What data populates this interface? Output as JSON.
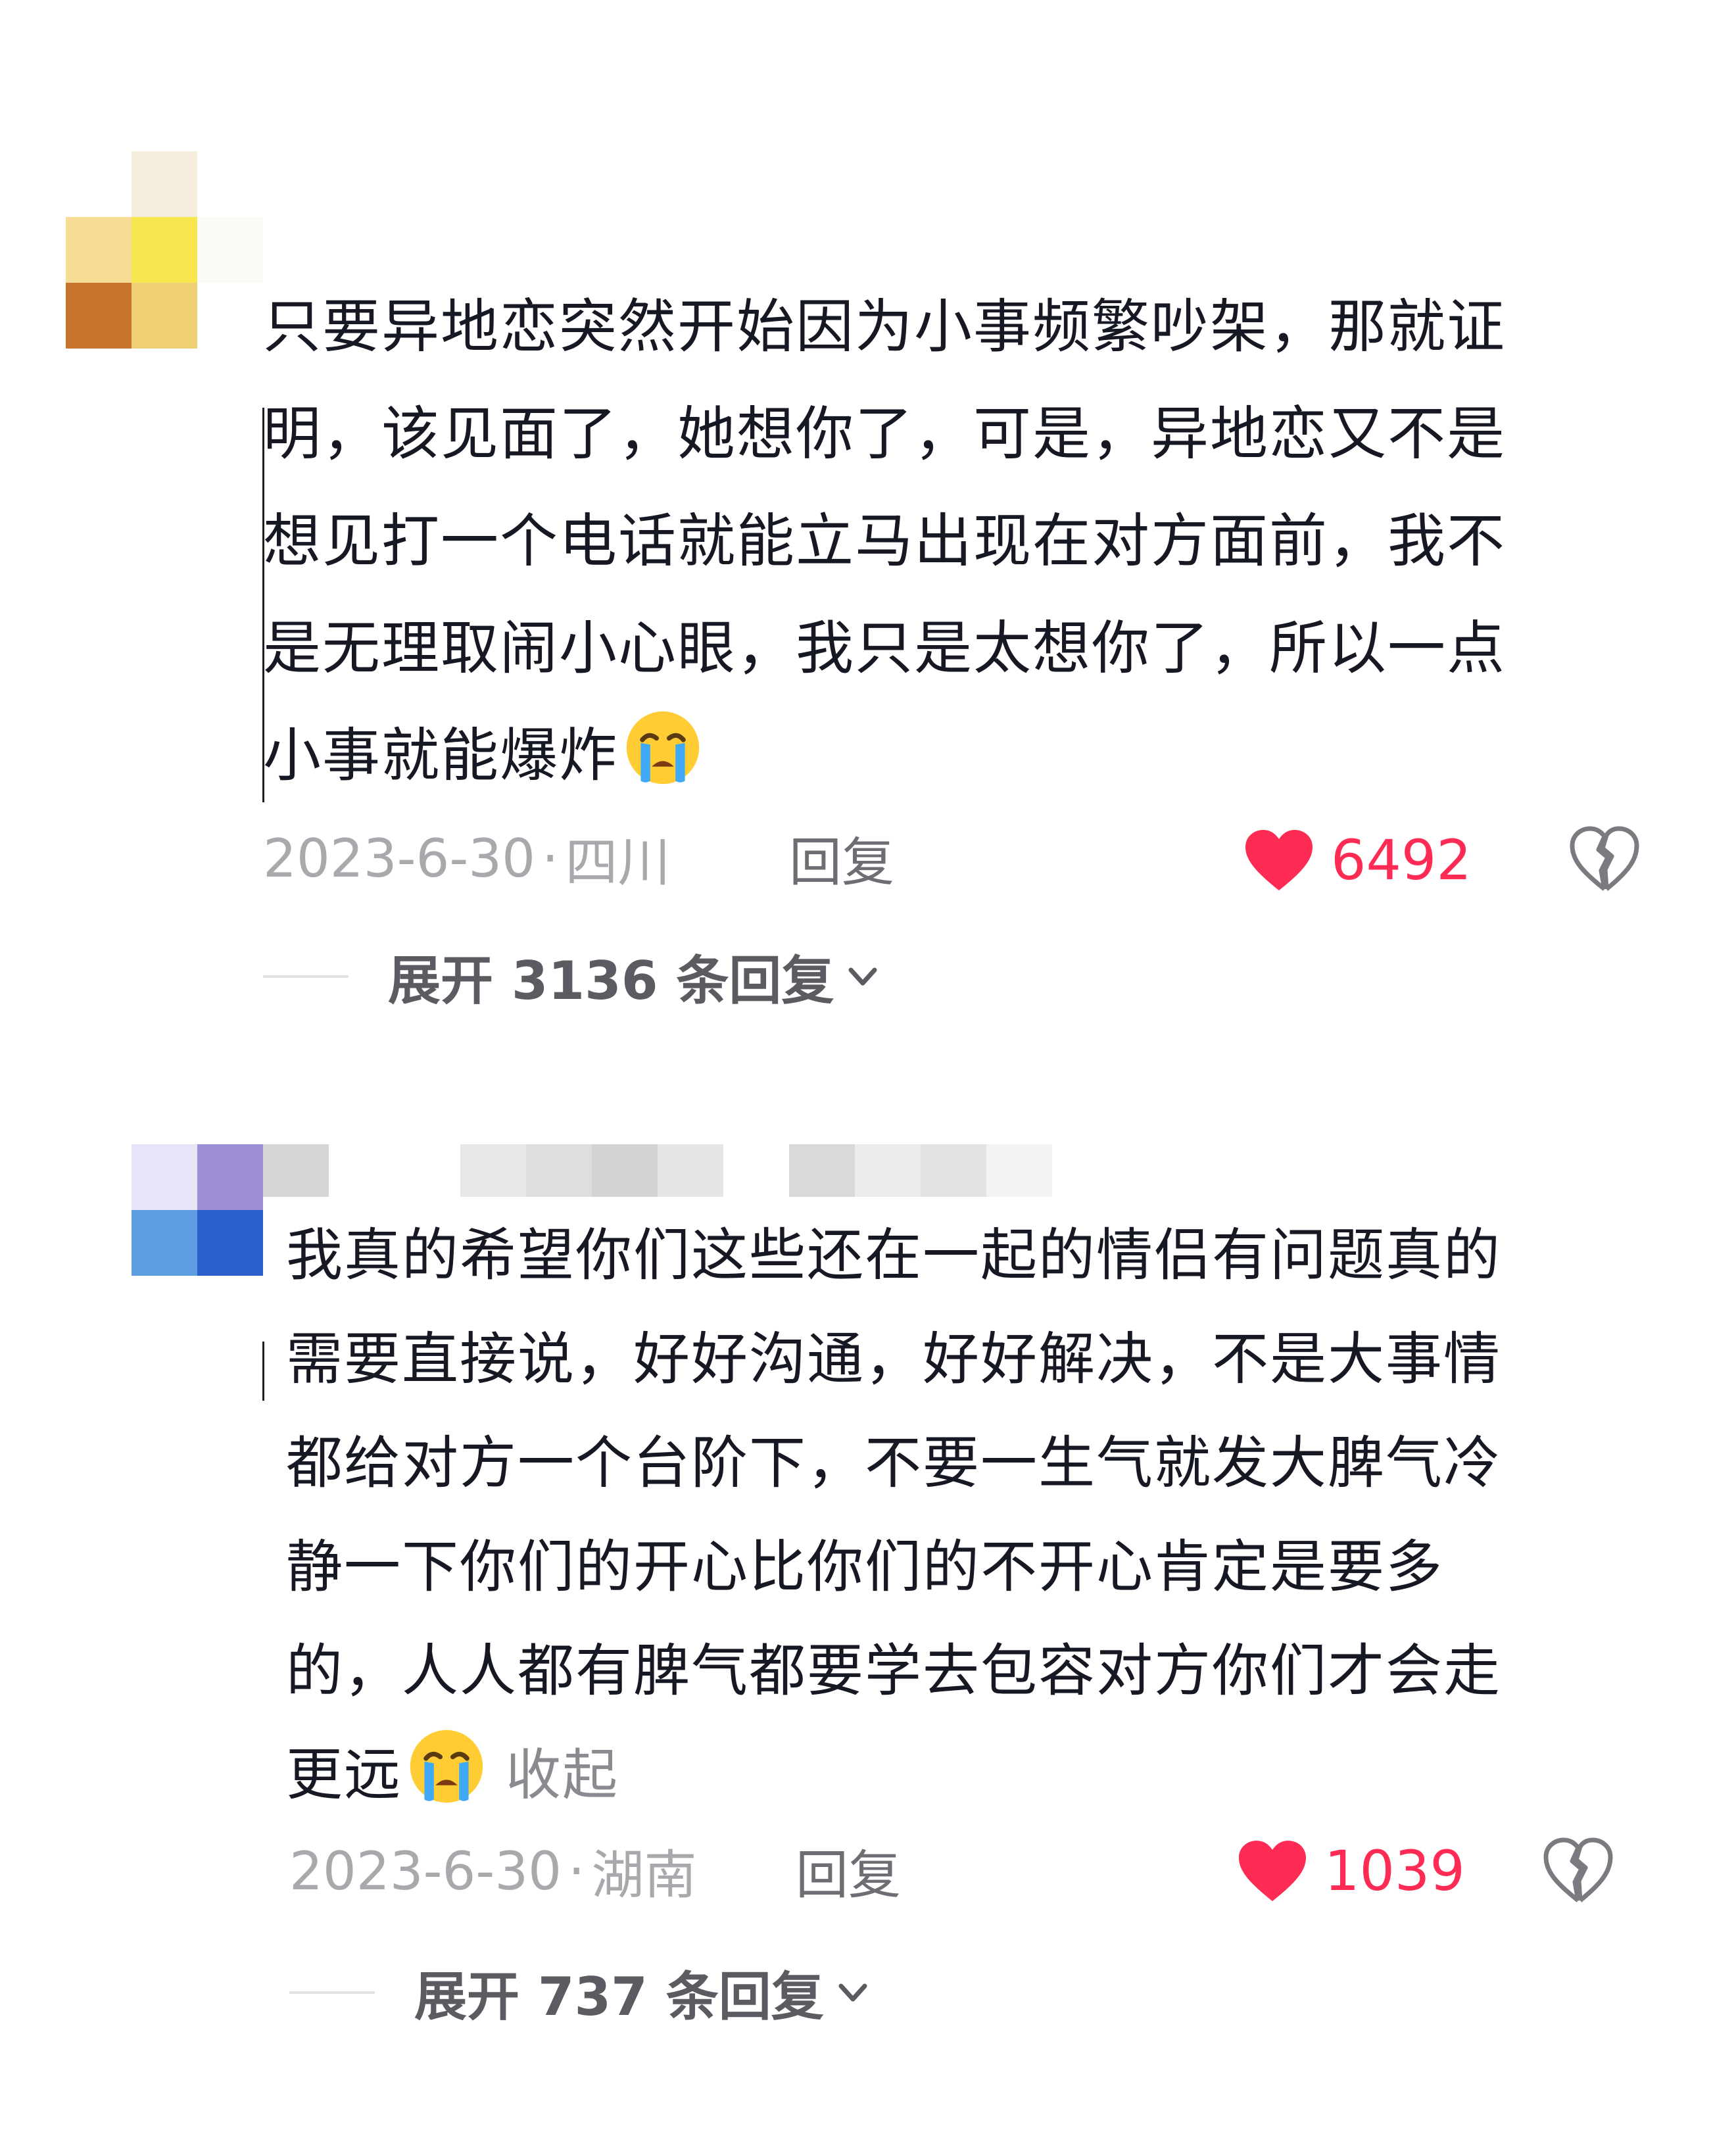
{
  "colors": {
    "accent_like": "#fe2c55",
    "meta_text": "#a8a8ad",
    "body_text": "#161823",
    "reply_text": "#6d6e74"
  },
  "comments": [
    {
      "avatar_pixels": [
        "#ffffff",
        "#f5eedd",
        "#ffffff",
        "#f6dc94",
        "#f8e64f",
        "#fbfaf5",
        "#c7742c",
        "#eecf74",
        "#ffffff"
      ],
      "text_lines": [
        "只要异地恋突然开始因为小事频繁吵架，那就证",
        "明，该见面了，她想你了，可是，异地恋又不是",
        "想见打一个电话就能立马出现在对方面前，我不",
        "是无理取闹小心眼，我只是太想你了，所以一点",
        "小事就能爆炸"
      ],
      "emoji": "crying-face",
      "date": "2023-6-30",
      "separator": "·",
      "location": "四川",
      "reply_label": "回复",
      "like_count": "6492",
      "expand_label": "展开 3136 条回复"
    },
    {
      "avatar_pixels": [
        "#e6e4f6",
        "#9e8ed8",
        "#d6d6d6",
        "#5d9de0",
        "#2b5fcc",
        "#ffffff"
      ],
      "text_lines": [
        "我真的希望你们这些还在一起的情侣有问题真的",
        "需要直接说，好好沟通，好好解决，不是大事情",
        "都给对方一个台阶下，不要一生气就发大脾气冷",
        "静一下你们的开心比你们的不开心肯定是要多",
        "的，人人都有脾气都要学去包容对方你们才会走",
        "更远"
      ],
      "emoji": "crying-face",
      "collapse_label": "收起",
      "date": "2023-6-30",
      "separator": "·",
      "location": "湖南",
      "reply_label": "回复",
      "like_count": "1039",
      "expand_label": "展开 737 条回复"
    }
  ]
}
